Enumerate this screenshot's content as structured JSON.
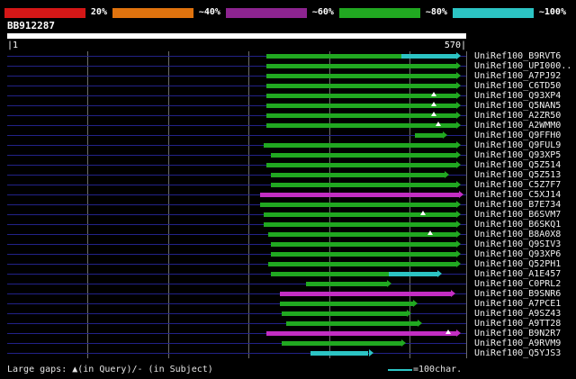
{
  "colors": {
    "background": "#000000",
    "row_line": "#222288",
    "grid_line": "#6e6e6e",
    "query_bar": "#ffffff",
    "green": "#21a821",
    "cyan": "#2cc4c4",
    "magenta": "#c32ec3",
    "red": "#d41717",
    "orange": "#e0730e",
    "purple": "#8d2490"
  },
  "scale_bar": {
    "segments": [
      {
        "name": "0-20",
        "color": "#d41717",
        "label_after": "20%"
      },
      {
        "name": "20-40",
        "color": "#e0730e",
        "label_after": "~40%"
      },
      {
        "name": "40-60",
        "color": "#8d2490",
        "label_after": "~60%"
      },
      {
        "name": "60-80",
        "color": "#21a821",
        "label_after": "~80%"
      },
      {
        "name": "80-100",
        "color": "#2cc4c4",
        "label_after": "~100%"
      }
    ]
  },
  "query": {
    "id": "BB912287",
    "start_label": "|1",
    "end_label": "570|",
    "length": 570
  },
  "footer": {
    "gaps_note": "Large gaps: ▲(in Query)/- (in Subject)",
    "scale_note": "=100char."
  },
  "chart_data": {
    "type": "alignment-overview",
    "title": "BLAST hit distribution for query BB912287",
    "query_length": 570,
    "gridlines_seq": [
      100,
      200,
      300,
      400,
      500,
      570
    ],
    "legend": "percent identity color scale: red <20%, orange ~40%, purple ~60%, green ~80%, cyan ~100%",
    "hits": [
      {
        "label": "UniRef100_B9RVT6",
        "segments": [
          {
            "from": 322,
            "to": 490,
            "color": "green"
          },
          {
            "from": 490,
            "to": 558,
            "color": "cyan"
          }
        ],
        "gaps": []
      },
      {
        "label": "UniRef100_UPI000..",
        "segments": [
          {
            "from": 322,
            "to": 558,
            "color": "green"
          }
        ],
        "gaps": []
      },
      {
        "label": "UniRef100_A7PJ92",
        "segments": [
          {
            "from": 322,
            "to": 558,
            "color": "green"
          }
        ],
        "gaps": []
      },
      {
        "label": "UniRef100_C6TD50",
        "segments": [
          {
            "from": 322,
            "to": 558,
            "color": "green"
          }
        ],
        "gaps": []
      },
      {
        "label": "UniRef100_Q93XP4",
        "segments": [
          {
            "from": 322,
            "to": 558,
            "color": "green"
          }
        ],
        "gaps": [
          530
        ]
      },
      {
        "label": "UniRef100_Q5NAN5",
        "segments": [
          {
            "from": 322,
            "to": 558,
            "color": "green"
          }
        ],
        "gaps": [
          530
        ]
      },
      {
        "label": "UniRef100_A2ZR50",
        "segments": [
          {
            "from": 322,
            "to": 558,
            "color": "green"
          }
        ],
        "gaps": [
          530
        ]
      },
      {
        "label": "UniRef100_A2WMM0",
        "segments": [
          {
            "from": 322,
            "to": 558,
            "color": "green"
          }
        ],
        "gaps": [
          535
        ]
      },
      {
        "label": "UniRef100_Q9FFH0",
        "segments": [
          {
            "from": 506,
            "to": 541,
            "color": "green"
          }
        ],
        "gaps": []
      },
      {
        "label": "UniRef100_Q9FUL9",
        "segments": [
          {
            "from": 319,
            "to": 558,
            "color": "green"
          }
        ],
        "gaps": []
      },
      {
        "label": "UniRef100_Q93XP5",
        "segments": [
          {
            "from": 327,
            "to": 558,
            "color": "green"
          }
        ],
        "gaps": []
      },
      {
        "label": "UniRef100_Q5Z514",
        "segments": [
          {
            "from": 322,
            "to": 558,
            "color": "green"
          }
        ],
        "gaps": []
      },
      {
        "label": "UniRef100_Q5Z513",
        "segments": [
          {
            "from": 327,
            "to": 543,
            "color": "green"
          }
        ],
        "gaps": []
      },
      {
        "label": "UniRef100_C5Z7F7",
        "segments": [
          {
            "from": 327,
            "to": 558,
            "color": "green"
          }
        ],
        "gaps": []
      },
      {
        "label": "UniRef100_C5XJ14",
        "segments": [
          {
            "from": 314,
            "to": 561,
            "color": "magenta"
          }
        ],
        "gaps": []
      },
      {
        "label": "UniRef100_B7E734",
        "segments": [
          {
            "from": 314,
            "to": 558,
            "color": "green"
          }
        ],
        "gaps": []
      },
      {
        "label": "UniRef100_B6SVM7",
        "segments": [
          {
            "from": 319,
            "to": 558,
            "color": "green"
          }
        ],
        "gaps": [
          516
        ]
      },
      {
        "label": "UniRef100_B6SKQ1",
        "segments": [
          {
            "from": 319,
            "to": 558,
            "color": "green"
          }
        ],
        "gaps": []
      },
      {
        "label": "UniRef100_B8A0X8",
        "segments": [
          {
            "from": 324,
            "to": 558,
            "color": "green"
          }
        ],
        "gaps": [
          525
        ]
      },
      {
        "label": "UniRef100_Q9SIV3",
        "segments": [
          {
            "from": 327,
            "to": 558,
            "color": "green"
          }
        ],
        "gaps": []
      },
      {
        "label": "UniRef100_Q93XP6",
        "segments": [
          {
            "from": 327,
            "to": 558,
            "color": "green"
          }
        ],
        "gaps": []
      },
      {
        "label": "UniRef100_Q52PH1",
        "segments": [
          {
            "from": 324,
            "to": 558,
            "color": "green"
          }
        ],
        "gaps": []
      },
      {
        "label": "UniRef100_A1E457",
        "segments": [
          {
            "from": 327,
            "to": 474,
            "color": "green"
          },
          {
            "from": 474,
            "to": 534,
            "color": "cyan"
          }
        ],
        "gaps": []
      },
      {
        "label": "UniRef100_C0PRL2",
        "segments": [
          {
            "from": 371,
            "to": 472,
            "color": "green"
          }
        ],
        "gaps": []
      },
      {
        "label": "UniRef100_B9SNR6",
        "segments": [
          {
            "from": 339,
            "to": 551,
            "color": "magenta"
          }
        ],
        "gaps": []
      },
      {
        "label": "UniRef100_A7PCE1",
        "segments": [
          {
            "from": 339,
            "to": 504,
            "color": "green"
          }
        ],
        "gaps": []
      },
      {
        "label": "UniRef100_A9SZ43",
        "segments": [
          {
            "from": 341,
            "to": 496,
            "color": "green"
          }
        ],
        "gaps": []
      },
      {
        "label": "UniRef100_A9TT28",
        "segments": [
          {
            "from": 347,
            "to": 510,
            "color": "green"
          }
        ],
        "gaps": []
      },
      {
        "label": "UniRef100_B9N2R7",
        "segments": [
          {
            "from": 322,
            "to": 558,
            "color": "magenta"
          }
        ],
        "gaps": [
          548
        ]
      },
      {
        "label": "UniRef100_A9RVM9",
        "segments": [
          {
            "from": 341,
            "to": 490,
            "color": "green"
          }
        ],
        "gaps": []
      },
      {
        "label": "UniRef100_Q5YJS3",
        "segments": [
          {
            "from": 377,
            "to": 449,
            "color": "cyan"
          }
        ],
        "gaps": []
      }
    ]
  }
}
